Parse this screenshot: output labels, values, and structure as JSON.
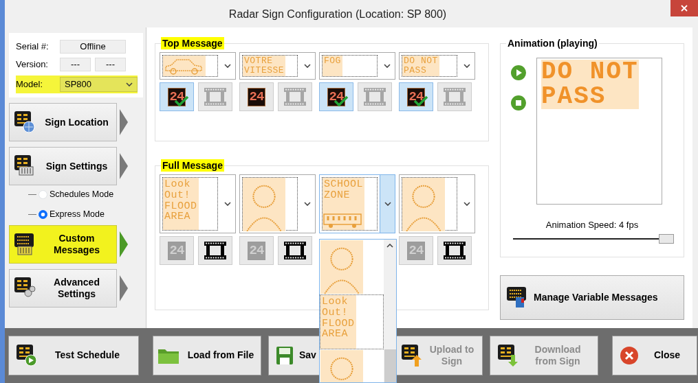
{
  "window": {
    "title": "Radar Sign Configuration (Location: SP 800)"
  },
  "device_info": {
    "serial_label": "Serial #:",
    "serial_value": "Offline",
    "version_label": "Version:",
    "version_values": [
      "---",
      "---"
    ],
    "model_label": "Model:",
    "model_value": "SP800"
  },
  "nav": [
    {
      "label": "Sign Location",
      "selected": false
    },
    {
      "label": "Sign Settings",
      "selected": false,
      "children": [
        {
          "label": "Schedules Mode",
          "selected": false
        },
        {
          "label": "Express Mode",
          "selected": true
        }
      ]
    },
    {
      "label": "Custom Messages",
      "selected": true
    },
    {
      "label": "Advanced Settings",
      "selected": false
    }
  ],
  "top_message": {
    "title": "Top Message",
    "slots": [
      {
        "preview": {
          "kind": "car"
        },
        "dropdown_open": false,
        "speed_display": {
          "text": "24",
          "selected": true,
          "disabled": false
        },
        "animation_disabled": true
      },
      {
        "preview": {
          "kind": "text",
          "lines": [
            "VOTRE",
            "VITESSE"
          ]
        },
        "dropdown_open": false,
        "speed_display": {
          "text": "24",
          "selected": false,
          "disabled": false
        },
        "animation_disabled": true
      },
      {
        "preview": {
          "kind": "text",
          "lines": [
            "FOG"
          ]
        },
        "dropdown_open": false,
        "speed_display": {
          "text": "24",
          "selected": true,
          "disabled": false
        },
        "animation_disabled": true
      },
      {
        "preview": {
          "kind": "text",
          "lines": [
            "DO NOT",
            "PASS"
          ]
        },
        "dropdown_open": false,
        "speed_display": {
          "text": "24",
          "selected": true,
          "disabled": false
        },
        "animation_disabled": true
      }
    ]
  },
  "full_message": {
    "title": "Full Message",
    "slots": [
      {
        "preview": {
          "kind": "text",
          "lines": [
            "Look",
            "Out!",
            "FLOOD",
            "AREA"
          ]
        },
        "dropdown_open": false,
        "speed_display": {
          "text": "24",
          "selected": false,
          "disabled": true
        },
        "animation_disabled": false
      },
      {
        "preview": {
          "kind": "person"
        },
        "dropdown_open": false,
        "speed_display": {
          "text": "24",
          "selected": false,
          "disabled": true
        },
        "animation_disabled": false
      },
      {
        "preview": {
          "kind": "bus_text",
          "lines": [
            "SCHOOL",
            "ZONE"
          ]
        },
        "dropdown_open": true
      },
      {
        "preview": {
          "kind": "person"
        },
        "dropdown_open": false,
        "speed_display": {
          "text": "24",
          "selected": false,
          "disabled": true
        },
        "animation_disabled": false
      }
    ]
  },
  "dropdown_list": {
    "items": [
      {
        "kind": "person",
        "selected": false
      },
      {
        "kind": "text",
        "lines": [
          "Look",
          "Out!",
          "FLOOD",
          "AREA"
        ],
        "selected": true
      },
      {
        "kind": "person",
        "selected": false
      }
    ]
  },
  "animation": {
    "title": "Animation (playing)",
    "preview_lines": [
      "DO NOT",
      "PASS"
    ],
    "speed_label": "Animation Speed: 4 fps",
    "level": 1
  },
  "manage_button": {
    "label": "Manage Variable Messages"
  },
  "toolbar": [
    {
      "label": "Test Schedule",
      "disabled": false
    },
    {
      "label": "Load from File",
      "disabled": false
    },
    {
      "label": "Sav",
      "disabled": false
    },
    {
      "label": "Upload to Sign",
      "disabled": true
    },
    {
      "label": "Download from Sign",
      "disabled": true
    },
    {
      "label": "Close",
      "disabled": false
    }
  ]
}
